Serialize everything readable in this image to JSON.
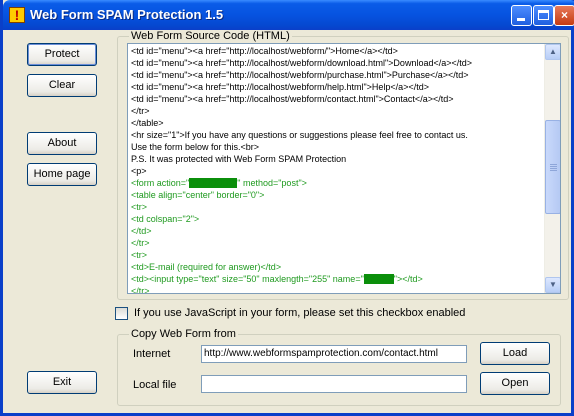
{
  "window": {
    "title": "Web Form SPAM Protection 1.5",
    "controls": {
      "minimize": "minimize",
      "maximize": "maximize",
      "close": "×"
    }
  },
  "buttons": {
    "protect": "Protect",
    "clear": "Clear",
    "about": "About",
    "home_page": "Home page",
    "exit": "Exit",
    "load": "Load",
    "open": "Open"
  },
  "source_group": {
    "label": "Web Form Source Code (HTML)",
    "lines": [
      {
        "text": "<td id=\"menu\"><a href=\"http://localhost/webform/\">Home</a></td>",
        "style": "black"
      },
      {
        "text": "<td id=\"menu\"><a href=\"http://localhost/webform/download.html\">Download</a></td>",
        "style": "black"
      },
      {
        "text": "<td id=\"menu\"><a href=\"http://localhost/webform/purchase.html\">Purchase</a></td>",
        "style": "black"
      },
      {
        "text": "<td id=\"menu\"><a href=\"http://localhost/webform/help.html\">Help</a></td>",
        "style": "black"
      },
      {
        "text": "<td id=\"menu\"><a href=\"http://localhost/webform/contact.html\">Contact</a></td>",
        "style": "black"
      },
      {
        "text": "</tr>",
        "style": "black"
      },
      {
        "text": "</table>",
        "style": "black"
      },
      {
        "text": "<hr size=\"1\">If you have any questions or suggestions please feel free to contact us.",
        "style": "black"
      },
      {
        "text": "Use the form below for this.<br>",
        "style": "black"
      },
      {
        "text": "P.S. It was protected with Web Form SPAM Protection",
        "style": "black"
      },
      {
        "text": "<p>",
        "style": "black"
      },
      {
        "text": "<form action=\"",
        "style": "green",
        "hl": "XXXXXXXX",
        "after": "\" method=\"post\">"
      },
      {
        "text": "<table align=\"center\" border=\"0\">",
        "style": "green"
      },
      {
        "text": "<tr>",
        "style": "green"
      },
      {
        "text": "<td colspan=\"2\">",
        "style": "green"
      },
      {
        "text": "</td>",
        "style": "green"
      },
      {
        "text": "</tr>",
        "style": "green"
      },
      {
        "text": "<tr>",
        "style": "green"
      },
      {
        "text": "<td>E-mail (required for answer)</td>",
        "style": "green"
      },
      {
        "text": "<td><input type=\"text\" size=\"50\" maxlength=\"255\" name=\"",
        "style": "green",
        "hl": "XXXXX",
        "after": "\"></td>"
      },
      {
        "text": "</tr>",
        "style": "green"
      },
      {
        "text": "<tr>",
        "style": "green"
      }
    ]
  },
  "checkbox": {
    "label": "If you use JavaScript in your form, please set this checkbox enabled",
    "checked": false
  },
  "copy_group": {
    "label": "Copy Web Form from",
    "internet_label": "Internet",
    "internet_value": "http://www.webformspamprotection.com/contact.html",
    "local_label": "Local file",
    "local_value": ""
  },
  "colors": {
    "code_green": "#1f9a1f",
    "title_blue": "#0a5ce8",
    "window_bg": "#ece9d8"
  },
  "icons": {
    "app": "app-icon",
    "scroll_up": "▲",
    "scroll_down": "▼"
  }
}
